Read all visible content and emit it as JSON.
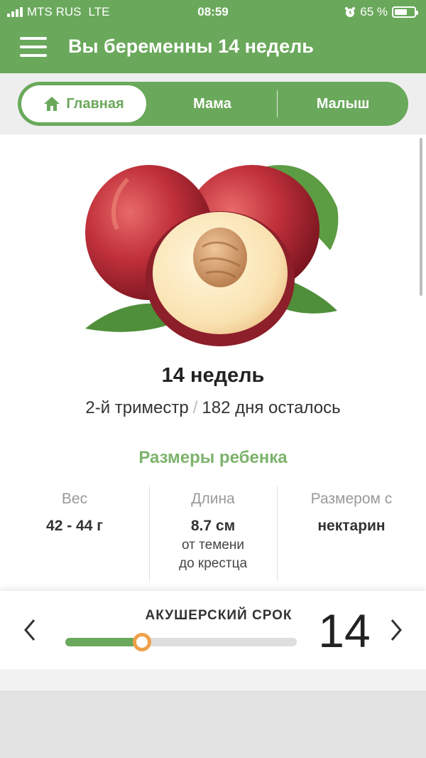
{
  "status_bar": {
    "carrier": "MTS RUS",
    "network": "LTE",
    "time": "08:59",
    "battery": "65 %",
    "battery_level": 0.65
  },
  "header": {
    "title": "Вы беременны 14 недель",
    "menu_icon": "hamburger-menu-icon"
  },
  "tabs": [
    {
      "label": "Главная",
      "icon": "home-icon",
      "active": true
    },
    {
      "label": "Мама",
      "active": false
    },
    {
      "label": "Малыш",
      "active": false
    }
  ],
  "week": {
    "title": "14 недель",
    "trimester": "2-й триместр",
    "separator": "/",
    "days_left": "182 дня осталось"
  },
  "sizes": {
    "title": "Размеры ребенка",
    "columns": [
      {
        "label": "Вес",
        "value": "42 - 44 г",
        "sub": ""
      },
      {
        "label": "Длина",
        "value": "8.7 см",
        "sub1": "от темени",
        "sub2": "до крестца"
      },
      {
        "label": "Размером с",
        "value": "нектарин"
      }
    ]
  },
  "term": {
    "label": "АКУШЕРСКИЙ СРОК",
    "value": "14",
    "progress": 0.33,
    "prev_icon": "chevron-left-icon",
    "next_icon": "chevron-right-icon"
  },
  "colors": {
    "brand_green": "#6aa85b",
    "accent_orange": "#f0a04b"
  }
}
